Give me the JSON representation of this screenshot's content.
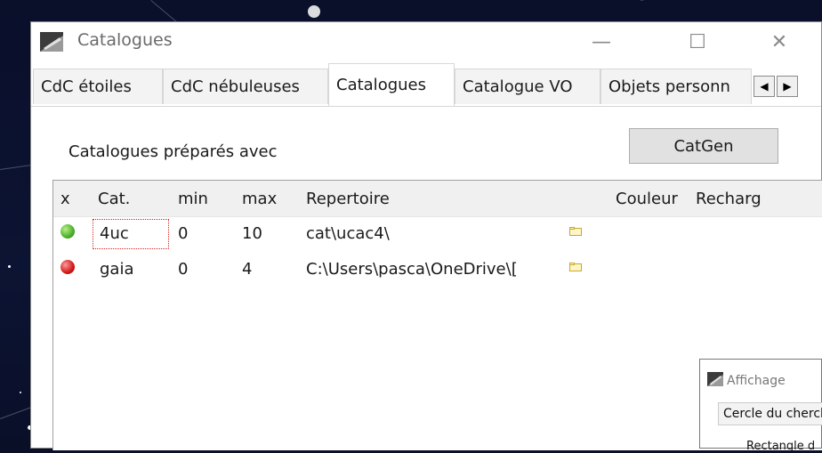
{
  "window": {
    "title": "Catalogues",
    "minimize": "—",
    "maximize": "☐",
    "close": "✕"
  },
  "tabs": [
    {
      "label": "CdC étoiles"
    },
    {
      "label": "CdC nébuleuses"
    },
    {
      "label": "Catalogues",
      "active": true
    },
    {
      "label": "Catalogue VO"
    },
    {
      "label": "Objets personn"
    }
  ],
  "tab_scroll": {
    "left": "◀",
    "right": "▶"
  },
  "prepared_label": "Catalogues préparés avec",
  "catgen_button": "CatGen",
  "grid": {
    "headers": [
      "x",
      "Cat.",
      "min",
      "max",
      "Repertoire",
      "Couleur",
      "Recharg"
    ],
    "rows": [
      {
        "status": "green",
        "cat": "4uc",
        "min": "0",
        "max": "10",
        "path": "cat\\ucac4\\"
      },
      {
        "status": "red",
        "cat": "gaia",
        "min": "0",
        "max": "4",
        "path": "C:\\Users\\pasca\\OneDrive\\["
      }
    ]
  },
  "colors": {
    "status_green": "#4caf2a",
    "status_red": "#d01818",
    "folder": "#e8c84a"
  },
  "mini_window": {
    "title": "Affichage",
    "tab": "Cercle du cherche",
    "body": "Rectangle d"
  }
}
